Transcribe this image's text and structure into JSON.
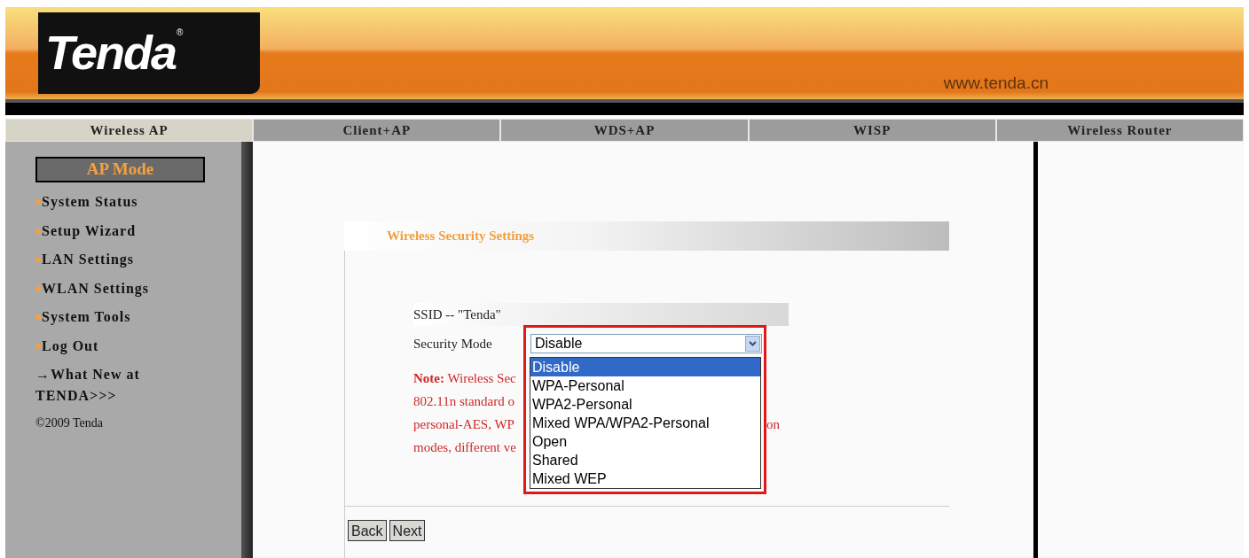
{
  "header": {
    "logo": "Tenda",
    "registered": "®",
    "url": "www.tenda.cn"
  },
  "tabs": [
    {
      "label": "Wireless AP",
      "selected": true
    },
    {
      "label": "Client+AP",
      "selected": false
    },
    {
      "label": "WDS+AP",
      "selected": false
    },
    {
      "label": "WISP",
      "selected": false
    },
    {
      "label": "Wireless Router",
      "selected": false
    }
  ],
  "sidebar": {
    "title": "AP Mode",
    "items": [
      "System Status",
      "Setup Wizard",
      "LAN Settings",
      "WLAN Settings",
      "System Tools",
      "Log Out"
    ],
    "news_link": "→What New at TENDA>>>",
    "copyright": "©2009 Tenda"
  },
  "panel": {
    "title": "Wireless Security Settings",
    "ssid": "SSID -- \"Tenda\"",
    "security_mode": {
      "label": "Security Mode",
      "value": "Disable",
      "expanded": true,
      "highlighted": true,
      "options": [
        {
          "label": "Disable",
          "selected": true
        },
        {
          "label": "WPA-Personal",
          "selected": false
        },
        {
          "label": "WPA2-Personal",
          "selected": false
        },
        {
          "label": "Mixed WPA/WPA2-Personal",
          "selected": false
        },
        {
          "label": "Open",
          "selected": false
        },
        {
          "label": "Shared",
          "selected": false
        },
        {
          "label": "Mixed WEP",
          "selected": false
        }
      ]
    },
    "note_lines": [
      {
        "text": "**Note:** Wireless Sec"
      },
      {
        "text": "802.11n standard o"
      },
      {
        "text": "personal-AES, WP",
        "tail": "on"
      },
      {
        "text": "modes, different ve"
      }
    ],
    "buttons": [
      "Back",
      "Next"
    ]
  }
}
